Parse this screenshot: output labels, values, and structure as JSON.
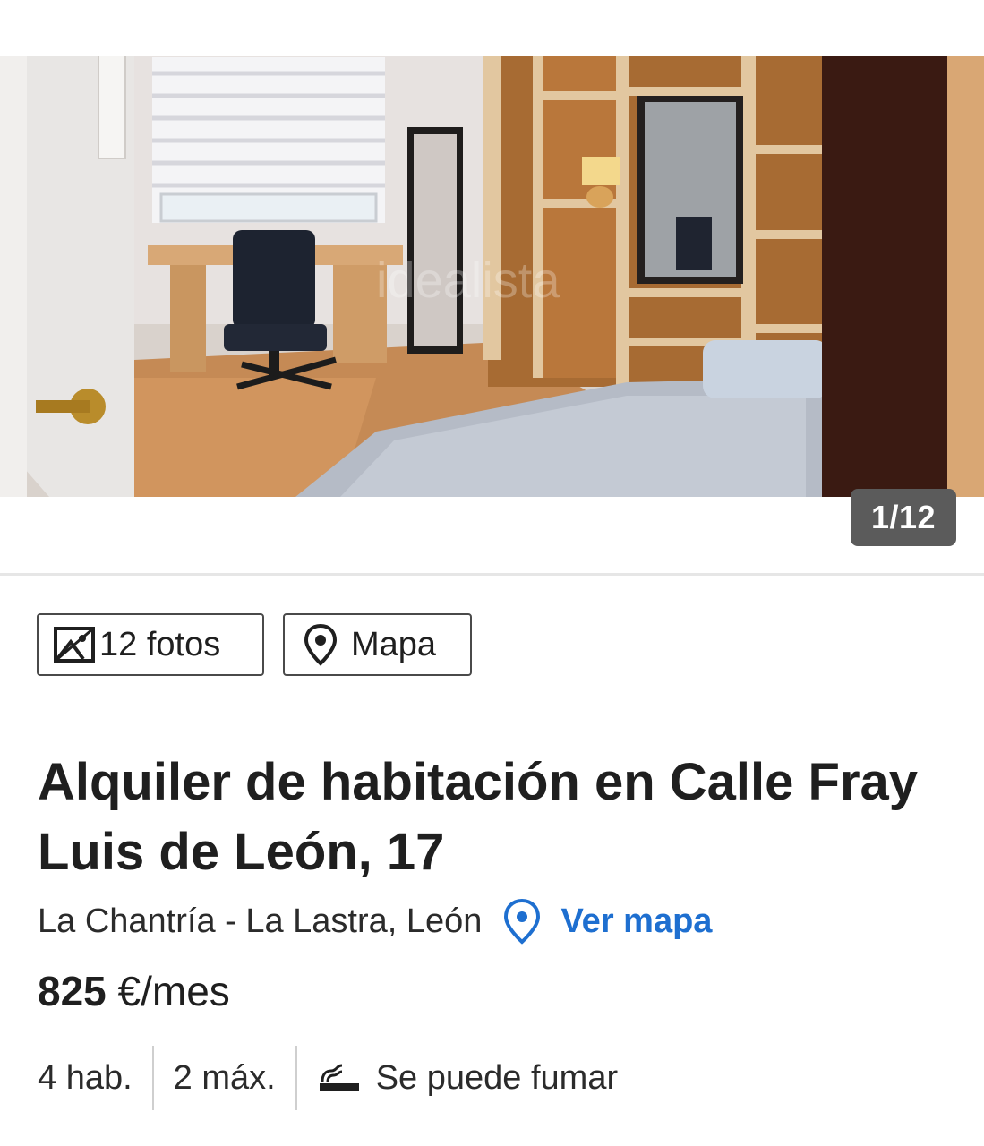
{
  "gallery": {
    "counter": "1/12",
    "watermark": "idealista"
  },
  "actions": {
    "photos_label": "12 fotos",
    "map_label": "Mapa"
  },
  "listing": {
    "title": "Alquiler de habitación en Calle Fray Luis de León, 17",
    "neighborhood": "La Chantría - La Lastra, León",
    "map_link": "Ver mapa",
    "price_amount": "825",
    "price_unit": "€/mes",
    "features": {
      "rooms": "4 hab.",
      "max_people": "2 máx.",
      "smoking": "Se puede fumar"
    }
  },
  "icons": {
    "photos": "image-icon",
    "map": "map-pin-icon",
    "smoking": "smoking-icon"
  },
  "colors": {
    "link": "#1e6fd0",
    "text": "#1f1f1f",
    "counter_bg": "#5b5b5b"
  }
}
